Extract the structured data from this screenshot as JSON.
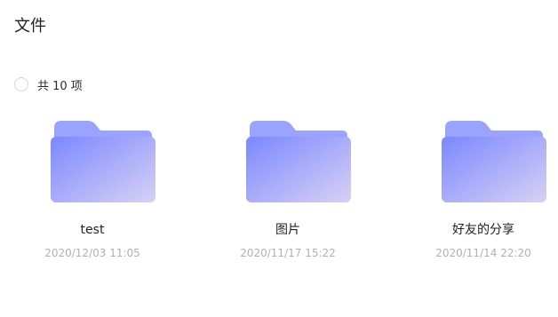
{
  "header": {
    "title": "文件"
  },
  "selection": {
    "count_label": "共 10 项"
  },
  "folders": [
    {
      "name": "test",
      "date": "2020/12/03 11:05"
    },
    {
      "name": "图片",
      "date": "2020/11/17 15:22"
    },
    {
      "name": "好友的分享",
      "date": "2020/11/14 22:20"
    }
  ],
  "colors": {
    "folder_tab": "#9aa4ff",
    "folder_front_start": "#7b88ff",
    "folder_front_end": "#d7d1f5",
    "date_text": "#b0b0b6"
  },
  "icons": {
    "folder": "folder-icon",
    "select_all": "radio-circle"
  }
}
